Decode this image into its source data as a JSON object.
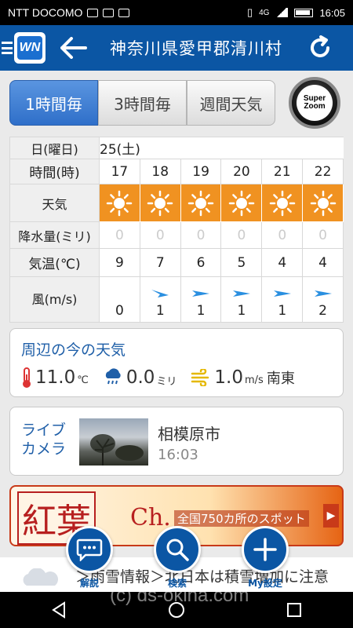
{
  "status_bar": {
    "carrier": "NTT DOCOMO",
    "network": "4G",
    "time": "16:05"
  },
  "header": {
    "title": "神奈川県愛甲郡清川村"
  },
  "tabs": [
    {
      "label": "1時間毎",
      "active": true
    },
    {
      "label": "3時間毎",
      "active": false
    },
    {
      "label": "週間天気",
      "active": false
    }
  ],
  "super_zoom": {
    "line1": "Super",
    "line2": "Zoom"
  },
  "forecast": {
    "row_labels": {
      "date": "日(曜日)",
      "time": "時間(時)",
      "weather": "天気",
      "rain": "降水量(ミリ)",
      "temp": "気温(℃)",
      "wind": "風(m/s)"
    },
    "date": "25(土)",
    "hours": [
      "17",
      "18",
      "19",
      "20",
      "21",
      "22"
    ],
    "weather_icons": [
      "sun-icon",
      "sun-icon",
      "sun-icon",
      "sun-icon",
      "sun-icon",
      "sun-icon"
    ],
    "rain": [
      "0",
      "0",
      "0",
      "0",
      "0",
      "0"
    ],
    "temp": [
      "9",
      "7",
      "6",
      "5",
      "4",
      "4"
    ],
    "wind": [
      "0",
      "1",
      "1",
      "1",
      "1",
      "2"
    ],
    "colors": {
      "weather_bg": "#f09221",
      "wind_arrow": "#2a8fe0"
    }
  },
  "now": {
    "title": "周辺の今の天気",
    "temp_value": "11.0",
    "temp_unit": "℃",
    "rain_value": "0.0",
    "rain_unit": "ミリ",
    "wind_value": "1.0",
    "wind_unit": "m/s",
    "wind_dir": "南東"
  },
  "camera": {
    "label_line1": "ライブ",
    "label_line2": "カメラ",
    "city": "相模原市",
    "time": "16:03"
  },
  "banner": {
    "kanji": "紅葉",
    "suffix": "Ch.",
    "promo": "全国750カ所のスポット"
  },
  "fabs": [
    {
      "label": "解説",
      "icon": "chat-icon"
    },
    {
      "label": "検索",
      "icon": "search-icon"
    },
    {
      "label": "My設定",
      "icon": "plus-icon"
    }
  ],
  "ticker": {
    "text": "＞雨雪情報＞北日本は積雪増加に注意"
  },
  "watermark": "(c) ds-okina.com",
  "theme": {
    "brand": "#0b56a4",
    "accent_text": "#1f5fa8"
  }
}
